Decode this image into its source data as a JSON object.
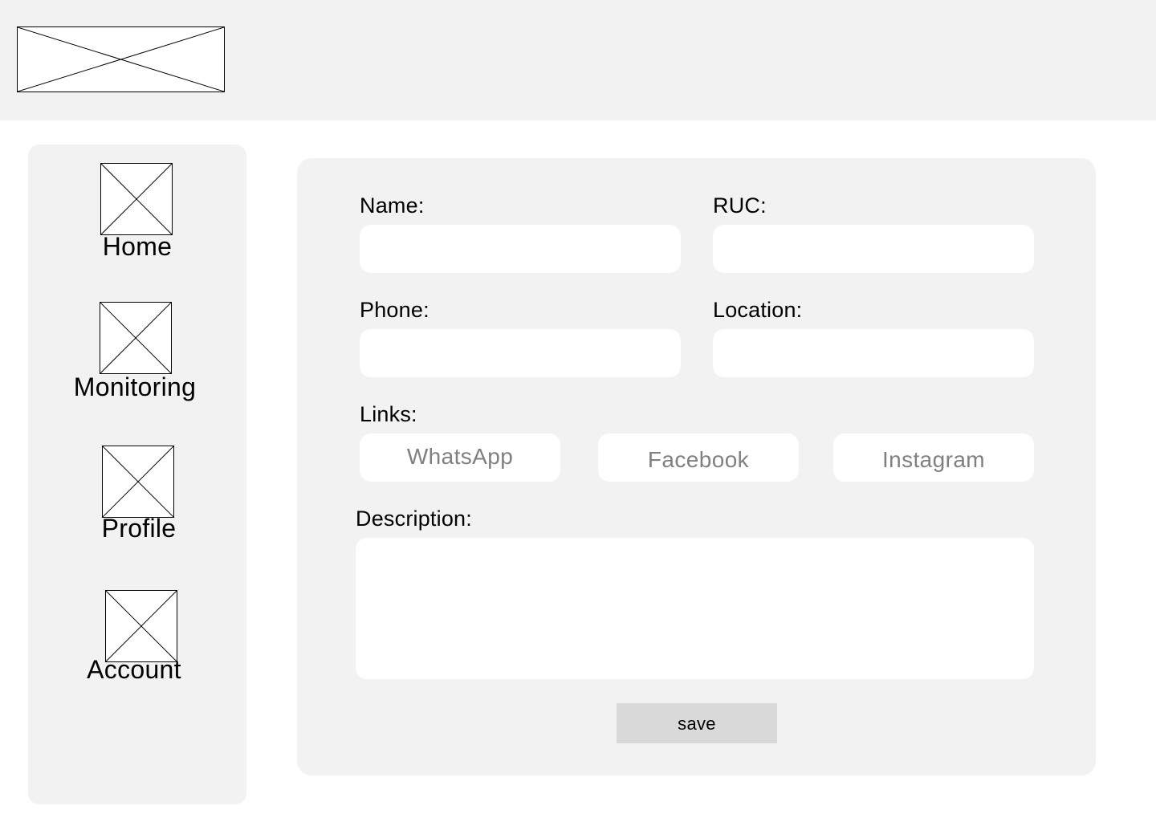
{
  "header": {
    "logo": "image-placeholder"
  },
  "sidebar": {
    "items": [
      {
        "label": "Home",
        "icon": "image-placeholder-icon"
      },
      {
        "label": "Monitoring",
        "icon": "image-placeholder-icon"
      },
      {
        "label": "Profile",
        "icon": "image-placeholder-icon"
      },
      {
        "label": "Account",
        "icon": "image-placeholder-icon"
      }
    ]
  },
  "form": {
    "name": {
      "label": "Name:",
      "value": ""
    },
    "ruc": {
      "label": "RUC:",
      "value": ""
    },
    "phone": {
      "label": "Phone:",
      "value": ""
    },
    "location": {
      "label": "Location:",
      "value": ""
    },
    "links": {
      "label": "Links:",
      "buttons": [
        "WhatsApp",
        "Facebook",
        "Instagram"
      ]
    },
    "description": {
      "label": "Description:",
      "value": ""
    },
    "save_label": "save"
  },
  "colors": {
    "panel_bg": "#f2f2f2",
    "field_bg": "#ffffff",
    "button_bg": "#d9d9d9",
    "link_text": "#808080"
  }
}
